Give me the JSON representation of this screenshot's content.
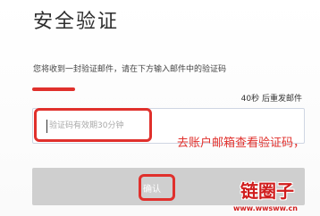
{
  "header": {
    "title": "安全验证"
  },
  "instructions": "您将收到一封验证邮件，请在下方输入邮件中的验证码",
  "resend": {
    "countdown_text": "40秒 后重发邮件"
  },
  "code_field": {
    "placeholder": "验证码有效期30分钟",
    "value": ""
  },
  "annotation": {
    "text": "去账户邮箱查看验证码，",
    "color": "#e0302c"
  },
  "confirm_button": {
    "label": "确认",
    "bg_color": "#cfcfcf"
  },
  "watermark": {
    "name": "链圈子",
    "url": "www.wwsww.cn",
    "color": "#d01d1d"
  }
}
